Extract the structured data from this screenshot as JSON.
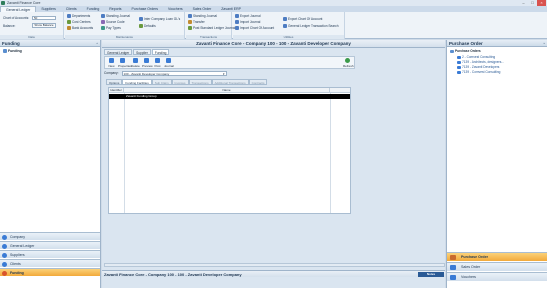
{
  "window": {
    "title": "Zavanti Finance Core"
  },
  "menu": [
    "General Ledger",
    "Suppliers",
    "Clients",
    "Funding",
    "Reports",
    "Purchase Orders",
    "Vouchers",
    "Sales Order",
    "Zavanti ERP"
  ],
  "ribbon": {
    "data_group": {
      "label": "Data",
      "chart_label": "Chart of Accounts:",
      "chart_value": "50",
      "balance_label": "Balance:",
      "balance_button": "Show Balance"
    },
    "maintenance_group": {
      "label": "Maintenance",
      "items": [
        "Departments",
        "Cost Centres",
        "Bank Accounts",
        "Standing Journal",
        "Source Code",
        "Pay Types",
        "Inter Company Loan GL's",
        "Defaults"
      ]
    },
    "transactions_group": {
      "label": "Transactions",
      "items": [
        "Standing Journal",
        "Transfer",
        "Post Standard Ledger Journal"
      ]
    },
    "utilities_group": {
      "label": "Utilities",
      "items": [
        "Export Journal",
        "Import Journal",
        "Import Chart Of Account",
        "Export Chart Of Account",
        "General Ledger Transaction Search"
      ]
    }
  },
  "left_panel": {
    "title": "Funding",
    "tree": [
      "Funding"
    ],
    "nav": [
      "Company",
      "General Ledger",
      "Suppliers",
      "Clients",
      "Funding"
    ],
    "active_nav": "Funding"
  },
  "center": {
    "title": "Zavanti Finance Core - Company 100 - 100 - Zavanti Developer Company",
    "doc_tabs": [
      "General Ledger",
      "Supplier",
      "Funding"
    ],
    "toolbar": [
      "New",
      "Properties",
      "Delete",
      "Preview",
      "Post",
      "Journal"
    ],
    "refresh": "Refresh",
    "company_label": "Company:",
    "company_value": "100 - Zavanti Developer Company",
    "sub_tabs": [
      "Options",
      "Funding Facilities",
      "Sub Claim",
      "Invoices",
      "Transactions",
      "Additional Transactions",
      "Contracts"
    ],
    "grid": {
      "columns": [
        "Identifier",
        "Name"
      ],
      "rows": [
        {
          "identifier": "",
          "name": "Zavanti Funding Group"
        }
      ]
    },
    "status_title": "Zavanti Finance Core - Company 100 - 100 - Zavanti Developer Company",
    "notes_button": "Notes"
  },
  "right_panel": {
    "title": "Purchase Order",
    "root": "Purchase Orders",
    "items": [
      "2 - Comvest Consulting",
      "7139 - Architects, designers...",
      "7139 - Zavanti Developers",
      "7139 - Comvest Consulting"
    ],
    "nav": [
      "Purchase Order",
      "Sales Order",
      "Vouchers"
    ],
    "active_nav": "Purchase Order"
  },
  "colors": {
    "accent": "#f2a93a",
    "brand": "#2a5a95",
    "header": "#1d3550"
  }
}
